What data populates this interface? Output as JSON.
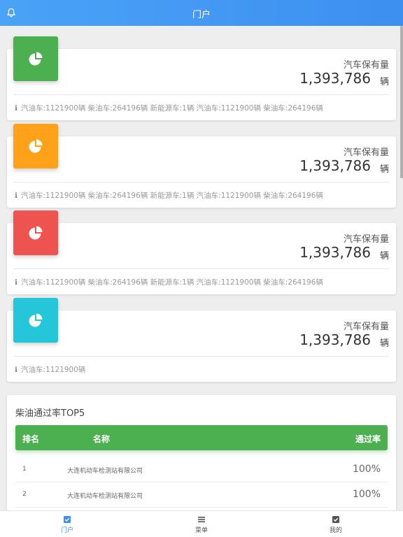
{
  "header": {
    "title": "门户",
    "bell_icon": "bell-icon"
  },
  "stat_label": "汽车保有量",
  "cards": [
    {
      "color": "#4caf50",
      "icon": "pie-chart-icon",
      "label": "汽车保有量",
      "value": "1,393,786",
      "unit": "辆",
      "footer": "汽油车:1121900辆 柴油车:264196辆 新能源车:1辆 汽油车:1121900辆 柴油车:264196辆"
    },
    {
      "color": "#ffa21a",
      "icon": "pie-chart-icon",
      "label": "汽车保有量",
      "value": "1,393,786",
      "unit": "辆",
      "footer": "汽油车:1121900辆 柴油车:264196辆 新能源车:1辆 汽油车:1121900辆 柴油车:264196辆"
    },
    {
      "color": "#ef5350",
      "icon": "pie-chart-icon",
      "label": "汽车保有量",
      "value": "1,393,786",
      "unit": "辆",
      "footer": "汽油车:1121900辆 柴油车:264196辆 新能源车:1辆 汽油车:1121900辆 柴油车:264196辆"
    },
    {
      "color": "#26c6da",
      "icon": "pie-chart-icon",
      "label": "汽车保有量",
      "value": "1,393,786",
      "unit": "辆",
      "footer": "汽油车:1121900辆"
    }
  ],
  "info_glyph": "i",
  "ranking": {
    "title": "柴油通过率TOP5",
    "header_color": "#4caf50",
    "columns": [
      "排名",
      "名称",
      "通过率"
    ],
    "rows": [
      {
        "rank": "1",
        "name": "大连机动车检测站有限公司",
        "rate": "100%"
      },
      {
        "rank": "2",
        "name": "大连机动车检测站有限公司",
        "rate": "100%"
      }
    ]
  },
  "tabbar": {
    "active_color": "#3d8ff0",
    "items": [
      {
        "label": "门户",
        "icon": "checkbox-icon",
        "active": true
      },
      {
        "label": "菜单",
        "icon": "menu-icon",
        "active": false
      },
      {
        "label": "我的",
        "icon": "checkbox-icon",
        "active": false
      }
    ]
  }
}
